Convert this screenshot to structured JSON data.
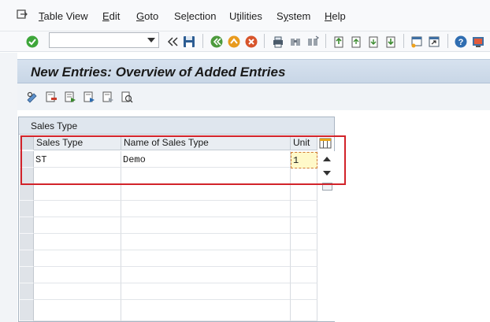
{
  "menu": {
    "items": [
      {
        "label": "Table View",
        "accel": "T"
      },
      {
        "label": "Edit",
        "accel": "E"
      },
      {
        "label": "Goto",
        "accel": "G"
      },
      {
        "label": "Selection",
        "accel": "l"
      },
      {
        "label": "Utilities",
        "accel": "t"
      },
      {
        "label": "System",
        "accel": "y"
      },
      {
        "label": "Help",
        "accel": "H"
      }
    ]
  },
  "toolbar": {
    "command_value": "",
    "icons": [
      "enter-icon",
      "back-icon",
      "save-icon",
      "back-nav-icon",
      "exit-icon",
      "cancel-icon",
      "print-icon",
      "find-icon",
      "find-next-icon",
      "first-page-icon",
      "prev-page-icon",
      "next-page-icon",
      "last-page-icon",
      "create-session-icon",
      "shortcut-icon",
      "help-icon",
      "layout-icon"
    ]
  },
  "page": {
    "title": "New Entries: Overview of Added Entries"
  },
  "table": {
    "caption": "Sales Type",
    "columns": [
      "Sales Type",
      "Name of Sales Type",
      "Unit"
    ],
    "rows": [
      {
        "sales_type": "ST",
        "name": "Demo",
        "unit": "1"
      }
    ]
  },
  "colors": {
    "highlight": "#d2232a",
    "title_bar": "#c8d6e6",
    "input_focus": "#fff9c9"
  }
}
